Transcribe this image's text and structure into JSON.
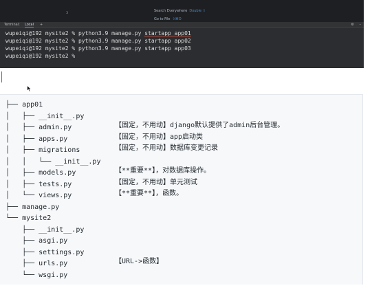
{
  "ide": {
    "search_everywhere": {
      "label": "Search Everywhere",
      "shortcut": "Double ⇧"
    },
    "go_to_file": {
      "label": "Go to File",
      "shortcut": "⇧⌘O"
    },
    "cursor_glyph": "ↄ",
    "tabs": {
      "terminal": "Terminal:",
      "local": "Local",
      "new": "+"
    },
    "settings_glyph": "⚙",
    "minimize_glyph": "–",
    "terminal_lines": [
      {
        "prompt": "wupeiqi@192 mysite2 % ",
        "command": "python3.9 manage.py ",
        "highlight": "startapp app01"
      },
      {
        "prompt": "wupeiqi@192 mysite2 % ",
        "command": "python3.9 manage.py startapp app02",
        "highlight": ""
      },
      {
        "prompt": "wupeiqi@192 mysite2 % ",
        "command": "python3.9 manage.py startapp app03",
        "highlight": ""
      },
      {
        "prompt": "wupeiqi@192 mysite2 % ",
        "command": "",
        "highlight": ""
      }
    ]
  },
  "tree": {
    "rows": [
      {
        "tree": "├── app01",
        "comment": ""
      },
      {
        "tree": "│   ├── __init__.py",
        "comment": ""
      },
      {
        "tree": "│   ├── admin.py",
        "comment": "【固定，不用动】django默认提供了admin后台管理。"
      },
      {
        "tree": "│   ├── apps.py",
        "comment": "【固定，不用动】app启动类"
      },
      {
        "tree": "│   ├── migrations",
        "comment": "【固定，不用动】数据库变更记录"
      },
      {
        "tree": "│   │   └── __init__.py",
        "comment": ""
      },
      {
        "tree": "│   ├── models.py",
        "comment": "【**重要**】，对数据库操作。"
      },
      {
        "tree": "│   ├── tests.py",
        "comment": "【固定，不用动】单元测试"
      },
      {
        "tree": "│   └── views.py",
        "comment": "【**重要**】，函数。"
      },
      {
        "tree": "├── manage.py",
        "comment": ""
      },
      {
        "tree": "└── mysite2",
        "comment": ""
      },
      {
        "tree": "    ├── __init__.py",
        "comment": ""
      },
      {
        "tree": "    ├── asgi.py",
        "comment": ""
      },
      {
        "tree": "    ├── settings.py",
        "comment": ""
      },
      {
        "tree": "    ├── urls.py",
        "comment": "【URL->函数】"
      },
      {
        "tree": "    └── wsgi.py",
        "comment": ""
      }
    ]
  }
}
